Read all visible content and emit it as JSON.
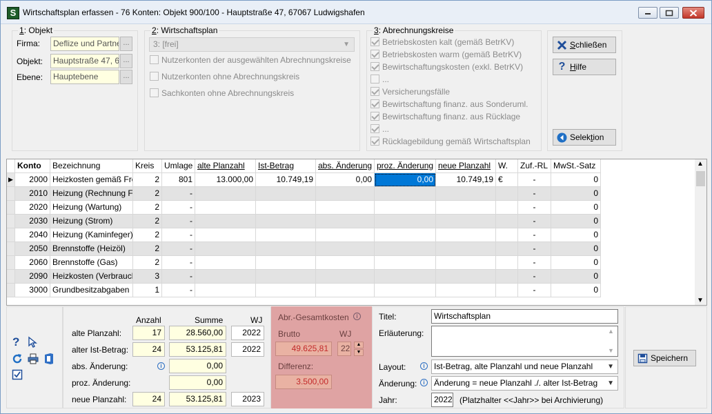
{
  "window": {
    "title": "Wirtschaftsplan erfassen - 76 Konten:  Objekt 900/100 - Hauptstraße 47, 67067 Ludwigshafen",
    "app_icon": "S"
  },
  "objekt_group": {
    "title_num": "1",
    "title_rest": ": Objekt",
    "firma_label": "Firma:",
    "firma_value": "Deflize und Partne",
    "objekt_label": "Objekt:",
    "objekt_value": "Hauptstraße 47, 6",
    "ebene_label": "Ebene:",
    "ebene_value": "Hauptebene",
    "ellipsis": "..."
  },
  "wp_group": {
    "title_num": "2",
    "title_rest": ": Wirtschaftsplan",
    "combo_value": "3: [frei]",
    "checkboxes": [
      "Nutzerkonten der ausgewählten Abrechnungskreise",
      "Nutzerkonten ohne Abrechnungskreis",
      "Sachkonten ohne Abrechnungskreis"
    ]
  },
  "ak_group": {
    "title_num": "3",
    "title_rest": ": Abrechnungskreise",
    "items": [
      "Betriebskosten kalt (gemäß BetrKV)",
      "Betriebskosten warm (gemäß BetrKV)",
      "Bewirtschaftungskosten (exkl. BetrKV)",
      "...",
      "Versicherungsfälle",
      "Bewirtschaftung finanz. aus Sonderuml.",
      "Bewirtschaftung finanz. aus Rücklage",
      "...",
      "Rücklagebildung gemäß Wirtschaftsplan"
    ]
  },
  "buttons": {
    "schliessen_u": "S",
    "schliessen_rest": "chließen",
    "hilfe_u": "H",
    "hilfe_rest": "ilfe",
    "selektion_pre": "Selek",
    "selektion_u": "t",
    "selektion_rest": "ion",
    "speichern": "Speichern"
  },
  "table": {
    "columns": [
      "Konto",
      "Bezeichnung",
      "Kreis",
      "Umlage",
      "alte Planzahl",
      "Ist-Betrag",
      "abs. Änderung",
      "proz. Änderung",
      "neue Planzahl",
      "W.",
      "Zuf.-RL",
      "MwSt.-Satz"
    ],
    "rows": [
      [
        "2000",
        "Heizkosten gemäß Fre",
        "2",
        "801",
        "13.000,00",
        "10.749,19",
        "0,00",
        "0,00",
        "10.749,19",
        "€",
        "-",
        "0"
      ],
      [
        "2010",
        "Heizung (Rechnung Fr",
        "2",
        "-",
        "",
        "",
        "",
        "",
        "",
        "",
        "-",
        "0"
      ],
      [
        "2020",
        "Heizung (Wartung)",
        "2",
        "-",
        "",
        "",
        "",
        "",
        "",
        "",
        "-",
        "0"
      ],
      [
        "2030",
        "Heizung (Strom)",
        "2",
        "-",
        "",
        "",
        "",
        "",
        "",
        "",
        "-",
        "0"
      ],
      [
        "2040",
        "Heizung (Kaminfeger)",
        "2",
        "-",
        "",
        "",
        "",
        "",
        "",
        "",
        "-",
        "0"
      ],
      [
        "2050",
        "Brennstoffe (Heizöl)",
        "2",
        "-",
        "",
        "",
        "",
        "",
        "",
        "",
        "-",
        "0"
      ],
      [
        "2060",
        "Brennstoffe (Gas)",
        "2",
        "-",
        "",
        "",
        "",
        "",
        "",
        "",
        "-",
        "0"
      ],
      [
        "2090",
        "Heizkosten (Verbrauch",
        "3",
        "-",
        "",
        "",
        "",
        "",
        "",
        "",
        "-",
        "0"
      ],
      [
        "3000",
        "Grundbesitzabgaben",
        "1",
        "-",
        "",
        "",
        "",
        "",
        "",
        "",
        "-",
        "0"
      ]
    ]
  },
  "summary": {
    "anzahl_header": "Anzahl",
    "summe_header": "Summe",
    "wj_header": "WJ",
    "rows": [
      {
        "label": "alte Planzahl:",
        "anzahl": "17",
        "summe": "28.560,00",
        "wj": "2022"
      },
      {
        "label": "alter Ist-Betrag:",
        "anzahl": "24",
        "summe": "53.125,81",
        "wj": "2022"
      },
      {
        "label": "abs. Änderung:",
        "anzahl": "",
        "summe": "0,00",
        "wj": ""
      },
      {
        "label": "proz. Änderung:",
        "anzahl": "",
        "summe": "0,00",
        "wj": ""
      },
      {
        "label": "neue Planzahl:",
        "anzahl": "24",
        "summe": "53.125,81",
        "wj": "2023"
      }
    ]
  },
  "abr": {
    "title": "Abr.-Gesamtkosten",
    "brutto_label": "Brutto",
    "wj_label": "WJ",
    "brutto_value": "49.625,81",
    "wj_value": "22",
    "differenz_label": "Differenz:",
    "differenz_value": "3.500,00"
  },
  "meta": {
    "titel_label": "Titel:",
    "titel_value": "Wirtschaftsplan",
    "erlaeuterung_label": "Erläuterung:",
    "erlaeuterung_value": "",
    "layout_label": "Layout:",
    "layout_value": "Ist-Betrag, alte Planzahl und neue Planzahl",
    "aenderung_label": "Änderung:",
    "aenderung_value": "Änderung = neue Planzahl ./. alter Ist-Betrag",
    "jahr_label": "Jahr:",
    "jahr_value": "2022",
    "jahr_hint": "(Platzhalter <<Jahr>> bei Archivierung)"
  },
  "icons": {
    "accent": "#0078d7",
    "pink_bg": "#dfa3a3",
    "diff_color": "#c32a2a"
  }
}
